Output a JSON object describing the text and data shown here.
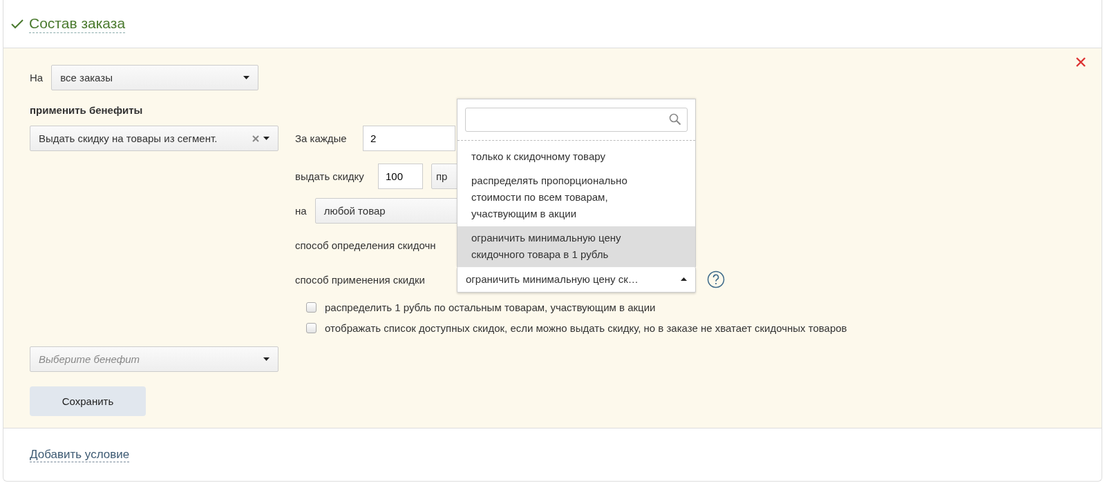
{
  "header": {
    "title": "Состав заказа",
    "checked": true
  },
  "scope": {
    "label": "На",
    "value": "все заказы"
  },
  "benefits_heading": "применить бенефиты",
  "benefit": {
    "value": "Выдать скидку на товары из сегмент.",
    "clearable": true
  },
  "form": {
    "every": {
      "label": "За каждые",
      "value": "2"
    },
    "discount": {
      "label": "выдать скидку",
      "value": "100",
      "unit": "пр"
    },
    "target": {
      "label": "на",
      "value": "любой товар"
    },
    "method_label": "способ определения скидочн",
    "apply": {
      "label": "способ применения скидки",
      "value": "ограничить минимальную цену ск…",
      "expanded": true,
      "options": [
        {
          "label": "только к скидочному товару",
          "selected": false
        },
        {
          "label": "распределять пропорционально стоимости по всем товарам, участвующим в акции",
          "selected": false
        },
        {
          "label": "ограничить минимальную цену скидочного товара в 1 рубль",
          "selected": true
        }
      ]
    }
  },
  "checkboxes": [
    {
      "label": "распределить 1 рубль по остальным товарам, участвующим в акции",
      "checked": false
    },
    {
      "label": "отображать список доступных скидок, если можно выдать скидку, но в заказе не хватает скидочных товаров",
      "checked": false
    }
  ],
  "new_benefit": {
    "placeholder": "Выберите бенефит"
  },
  "save_button": "Сохранить",
  "add_condition_link": "Добавить условие"
}
